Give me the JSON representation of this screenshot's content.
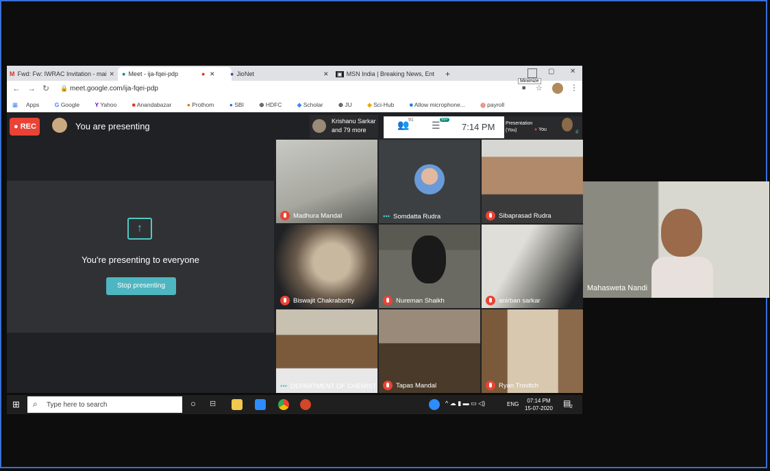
{
  "browser": {
    "tabs": [
      {
        "label": "Fwd: Fw: IWRAC Invitation - mai"
      },
      {
        "label": "Meet - ija-fqei-pdp"
      },
      {
        "label": "JioNet"
      },
      {
        "label": "MSN India | Breaking News, Ent"
      }
    ],
    "new_tab": "+",
    "minimize_tooltip": "Minimize",
    "url": "meet.google.com/ija-fqei-pdp",
    "bookmarks": [
      "Apps",
      "Google",
      "Yahoo",
      "Anandabazar",
      "Prothom",
      "SBI",
      "HDFC",
      "Scholar",
      "JU",
      "Sci-Hub",
      "Allow microphone...",
      "payroll"
    ]
  },
  "meet": {
    "rec_label": "REC",
    "presenting_label": "You are presenting",
    "presenting_everyone": "You're presenting to everyone",
    "stop_button": "Stop presenting",
    "participants_line1": "Krishanu Sarkar",
    "participants_line2": "and 79 more",
    "people_count": "91",
    "chat_badge": "99+",
    "time": "7:14 PM",
    "presentation_label": "Presentation",
    "presentation_you": "(You)",
    "you_label": "You",
    "tiles": [
      {
        "name": "Madhura Mandal"
      },
      {
        "name": "Somdatta Rudra"
      },
      {
        "name": "Sibaprasad Rudra"
      },
      {
        "name": "Biswajit Chakrabortty"
      },
      {
        "name": "Nureman Shaikh"
      },
      {
        "name": "anirban sarkar"
      },
      {
        "name": "DEPARTMENT OF CHEMIST"
      },
      {
        "name": "Tapas Mandal"
      },
      {
        "name": "Ryan Trovitch"
      }
    ],
    "speaker_name": "Mahasweta Nandi"
  },
  "taskbar": {
    "search_placeholder": "Type here to search",
    "lang": "ENG",
    "clock_time": "07:14 PM",
    "clock_date": "15-07-2020",
    "notif_count": "2"
  }
}
